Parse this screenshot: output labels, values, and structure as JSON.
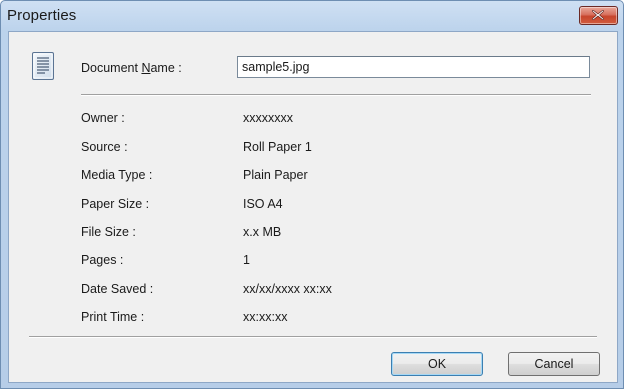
{
  "window": {
    "title": "Properties",
    "close_icon": "close-x-icon"
  },
  "document_name": {
    "label_before": "Document ",
    "label_access_key": "N",
    "label_after": "ame :",
    "value": "sample5.jpg",
    "icon": "document-lines-icon"
  },
  "properties": [
    {
      "label": "Owner :",
      "value": "xxxxxxxx"
    },
    {
      "label": "Source :",
      "value": "Roll Paper 1"
    },
    {
      "label": "Media Type :",
      "value": "Plain Paper"
    },
    {
      "label": "Paper Size :",
      "value": "ISO A4"
    },
    {
      "label": "File Size :",
      "value": "x.x MB"
    },
    {
      "label": "Pages :",
      "value": "1"
    },
    {
      "label": "Date Saved :",
      "value": "xx/xx/xxxx xx:xx"
    },
    {
      "label": "Print Time :",
      "value": "xx:xx:xx"
    }
  ],
  "buttons": {
    "ok_label": "OK",
    "cancel_label": "Cancel"
  },
  "colors": {
    "title_bar": "#bcd3ec",
    "client_bg": "#f0f0f0",
    "close_button": "#c7452c"
  }
}
